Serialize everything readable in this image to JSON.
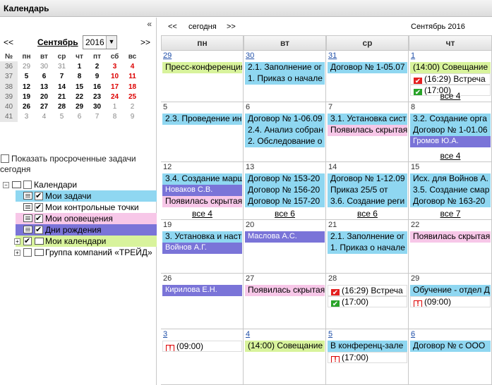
{
  "window": {
    "title": "Календарь"
  },
  "left": {
    "collapse": "«",
    "prev": "<<",
    "next": ">>",
    "month": "Сентябрь",
    "year": "2016",
    "mini_headers": [
      "№",
      "пн",
      "вт",
      "ср",
      "чт",
      "пт",
      "сб",
      "вс"
    ],
    "mini_rows": [
      [
        "36",
        "29",
        "30",
        "31",
        "1",
        "2",
        "3",
        "4"
      ],
      [
        "37",
        "5",
        "6",
        "7",
        "8",
        "9",
        "10",
        "11"
      ],
      [
        "38",
        "12",
        "13",
        "14",
        "15",
        "16",
        "17",
        "18"
      ],
      [
        "39",
        "19",
        "20",
        "21",
        "22",
        "23",
        "24",
        "25"
      ],
      [
        "40",
        "26",
        "27",
        "28",
        "29",
        "30",
        "1",
        "2"
      ],
      [
        "41",
        "3",
        "4",
        "5",
        "6",
        "7",
        "8",
        "9"
      ]
    ],
    "overdue_label": "Показать просроченные задачи сегодня",
    "tree": {
      "root": "Календари",
      "my_tasks": "Мои задачи",
      "my_checkpoints": "Мои контрольные точки",
      "my_alerts": "Мои оповещения",
      "birthdays": "Дни рождения",
      "my_calendars": "Мои календари",
      "group": "Группа компаний «ТРЕЙД»"
    },
    "colors": {
      "tasks": "#8fd7f1",
      "checkpoints": "#ffffff",
      "alerts": "#f7c7e8",
      "birthdays": "#7a74d8",
      "my_calendars": "#d8f39c"
    }
  },
  "header": {
    "prev": "<<",
    "today": "сегодня",
    "next": ">>",
    "period": "Сентябрь 2016",
    "days": [
      "пн",
      "вт",
      "ср",
      "чт"
    ]
  },
  "weeks": [
    {
      "days": [
        "29",
        "30",
        "31",
        "1"
      ],
      "links": [
        true,
        true,
        true,
        true
      ],
      "ev": [
        [
          {
            "t": "Пресс-конференция",
            "c": "green"
          }
        ],
        [
          {
            "t": "2.1. Заполнение ог",
            "c": "blue"
          },
          {
            "t": "1. Приказ о начале",
            "c": "blue"
          }
        ],
        [
          {
            "t": "Договор № 1-05.07",
            "c": "blue"
          }
        ],
        [
          {
            "t": "(14:00) Совещание",
            "c": "green"
          },
          {
            "t": "(16:29) Встреча",
            "c": "white",
            "m": "red"
          },
          {
            "t": "(17:00)",
            "c": "white",
            "m": "greenck"
          }
        ]
      ],
      "more": [
        "",
        "",
        "",
        "все 4"
      ]
    },
    {
      "days": [
        "5",
        "6",
        "7",
        "8"
      ],
      "links": [
        false,
        false,
        false,
        false
      ],
      "ev": [
        [
          {
            "t": "2.3. Проведение ин",
            "c": "blue"
          }
        ],
        [
          {
            "t": "Договор № 1-06.09",
            "c": "blue"
          },
          {
            "t": "2.4. Анализ собран",
            "c": "blue"
          },
          {
            "t": "2. Обследование о",
            "c": "blue"
          }
        ],
        [
          {
            "t": "3.1. Установка сист",
            "c": "blue"
          },
          {
            "t": "Появилась скрытая",
            "c": "pink"
          }
        ],
        [
          {
            "t": "3.2. Создание орга",
            "c": "blue"
          },
          {
            "t": "Договор № 1-01.06",
            "c": "blue"
          },
          {
            "t": "Громов Ю.А.",
            "c": "purple"
          }
        ]
      ],
      "more": [
        "",
        "",
        "",
        "все 4"
      ]
    },
    {
      "days": [
        "12",
        "13",
        "14",
        "15"
      ],
      "links": [
        false,
        false,
        false,
        false
      ],
      "ev": [
        [
          {
            "t": "3.4. Создание марш",
            "c": "blue"
          },
          {
            "t": "Новаков С.В.",
            "c": "purple"
          },
          {
            "t": "Появилась скрытая",
            "c": "pink"
          }
        ],
        [
          {
            "t": "Договор № 153-20",
            "c": "blue"
          },
          {
            "t": "Договор № 156-20",
            "c": "blue"
          },
          {
            "t": "Договор № 157-20",
            "c": "blue"
          }
        ],
        [
          {
            "t": "Договор № 1-12.09",
            "c": "blue"
          },
          {
            "t": "Приказ 25/5 от",
            "c": "blue"
          },
          {
            "t": "3.6. Создание реги",
            "c": "blue"
          }
        ],
        [
          {
            "t": "Исх. для Войнов А.",
            "c": "blue"
          },
          {
            "t": "3.5. Создание смар",
            "c": "blue"
          },
          {
            "t": "Договор № 163-20",
            "c": "blue"
          }
        ]
      ],
      "more": [
        "все 4",
        "все 6",
        "все 6",
        "все 7"
      ]
    },
    {
      "days": [
        "19",
        "20",
        "21",
        "22"
      ],
      "links": [
        false,
        false,
        false,
        false
      ],
      "ev": [
        [
          {
            "t": "3. Установка и наст",
            "c": "blue"
          },
          {
            "t": "Войнов А.Г.",
            "c": "purple"
          }
        ],
        [
          {
            "t": "Маслова А.С.",
            "c": "purple"
          }
        ],
        [
          {
            "t": "2.1. Заполнение ог",
            "c": "blue"
          },
          {
            "t": "1. Приказ о начале",
            "c": "blue"
          }
        ],
        [
          {
            "t": "Появилась скрытая",
            "c": "pink"
          }
        ]
      ],
      "more": [
        "",
        "",
        "",
        ""
      ]
    },
    {
      "days": [
        "26",
        "27",
        "28",
        "29"
      ],
      "links": [
        false,
        false,
        false,
        false
      ],
      "ev": [
        [
          {
            "t": "Кирилова Е.Н.",
            "c": "purple"
          }
        ],
        [
          {
            "t": "Появилась скрытая",
            "c": "pink"
          }
        ],
        [
          {
            "t": "(16:29) Встреча",
            "c": "white",
            "m": "red"
          },
          {
            "t": "(17:00)",
            "c": "white",
            "m": "greenck"
          }
        ],
        [
          {
            "t": "Обучение - отдел Д",
            "c": "blue"
          },
          {
            "t": "(09:00)",
            "c": "white",
            "m": "warn"
          }
        ]
      ],
      "more": [
        "",
        "",
        "",
        ""
      ]
    },
    {
      "days": [
        "3",
        "4",
        "5",
        "6"
      ],
      "links": [
        true,
        true,
        true,
        true
      ],
      "ev": [
        [
          {
            "t": "(09:00)",
            "c": "white",
            "m": "warn"
          }
        ],
        [
          {
            "t": "(14:00) Совещание",
            "c": "green"
          }
        ],
        [
          {
            "t": "В конференц-зале",
            "c": "blue"
          },
          {
            "t": "(17:00)",
            "c": "white",
            "m": "warn"
          }
        ],
        [
          {
            "t": "Договор № с ООО",
            "c": "blue"
          }
        ]
      ],
      "more": [
        "",
        "",
        "",
        ""
      ]
    }
  ]
}
